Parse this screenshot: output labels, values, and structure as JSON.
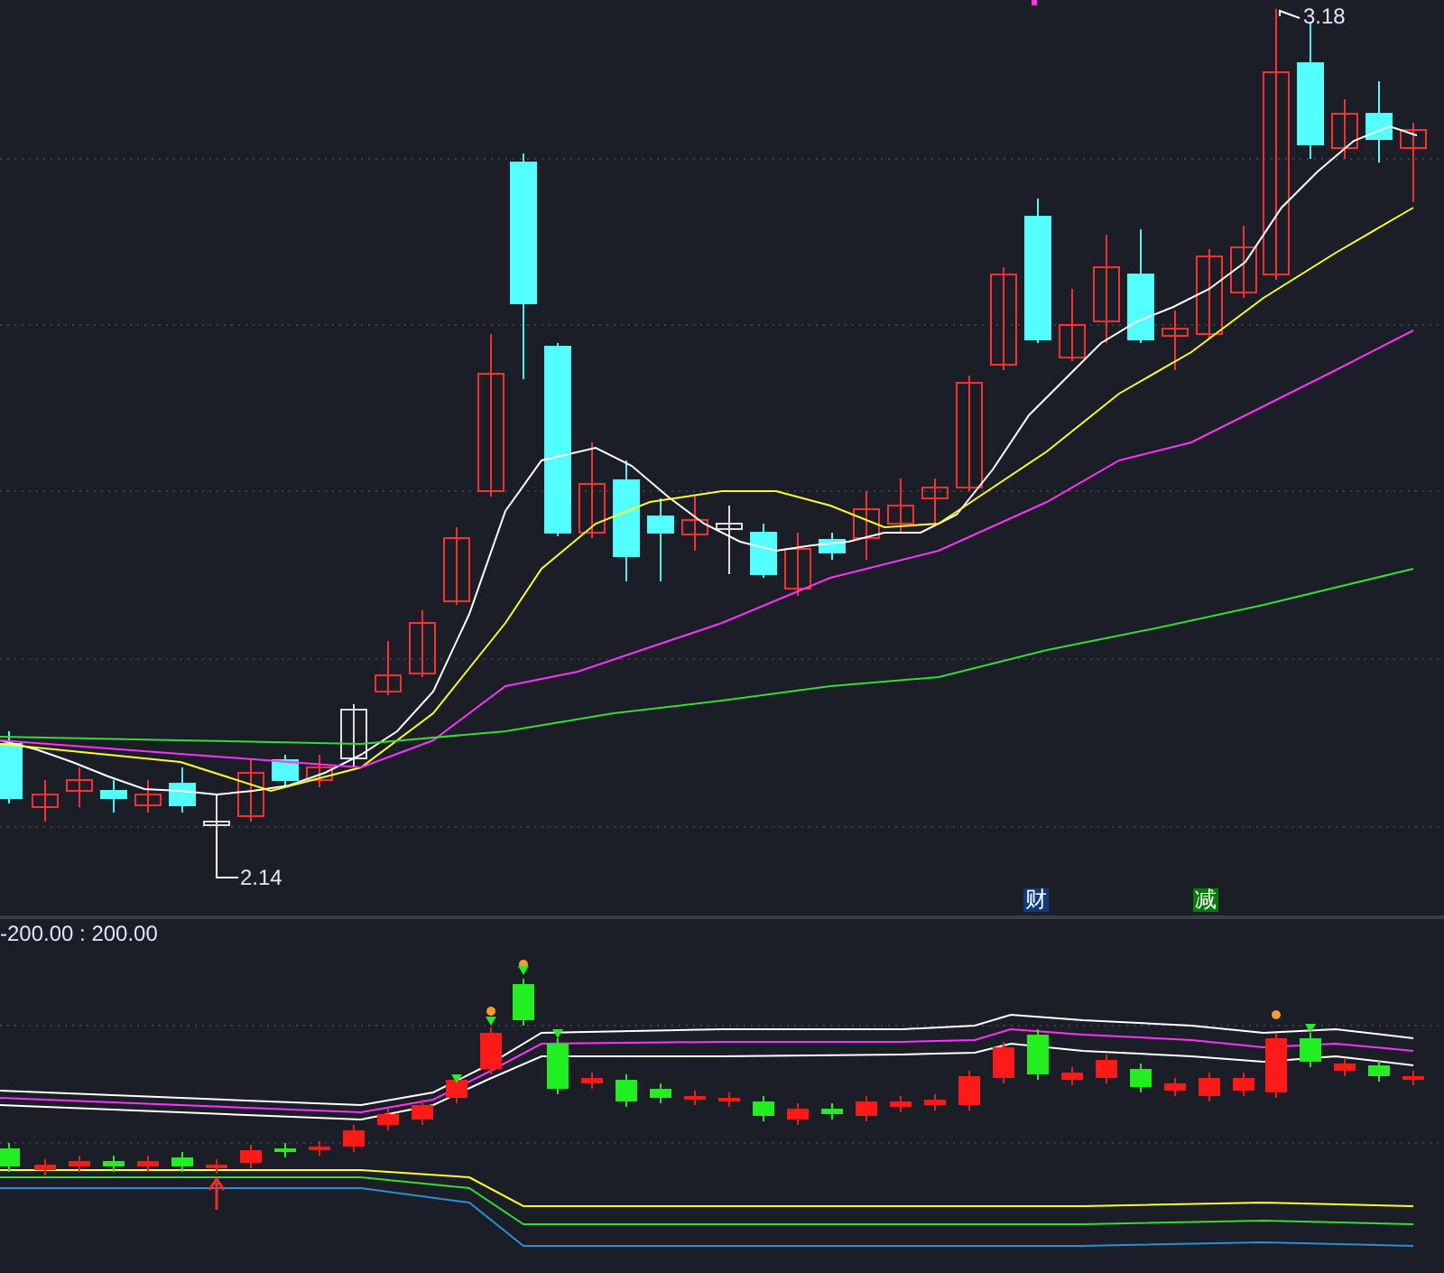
{
  "price_chart": {
    "high_label": "3.18",
    "low_label": "2.14",
    "markers": [
      {
        "text": "财",
        "color": "#0f3c78"
      },
      {
        "text": "减",
        "color": "#0a7a0a"
      }
    ]
  },
  "indicator": {
    "range_label": "-200.00 : 200.00"
  }
}
